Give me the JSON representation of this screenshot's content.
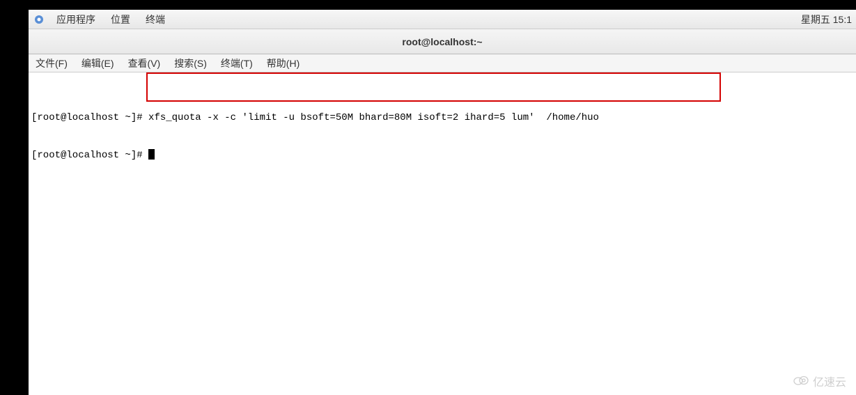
{
  "top_panel": {
    "apps": "应用程序",
    "places": "位置",
    "terminal": "终端",
    "datetime": "星期五 15:1"
  },
  "window": {
    "title": "root@localhost:~"
  },
  "menubar": {
    "file": "文件(F)",
    "edit": "编辑(E)",
    "view": "查看(V)",
    "search": "搜索(S)",
    "terminal": "终端(T)",
    "help": "帮助(H)"
  },
  "terminal": {
    "line1_prompt": "[root@localhost ~]#",
    "line1_cmd": " xfs_quota -x -c 'limit -u bsoft=50M bhard=80M isoft=2 ihard=5 lum'  /home/huo",
    "line2_prompt": "[root@localhost ~]# "
  },
  "watermark": {
    "text": "亿速云"
  }
}
